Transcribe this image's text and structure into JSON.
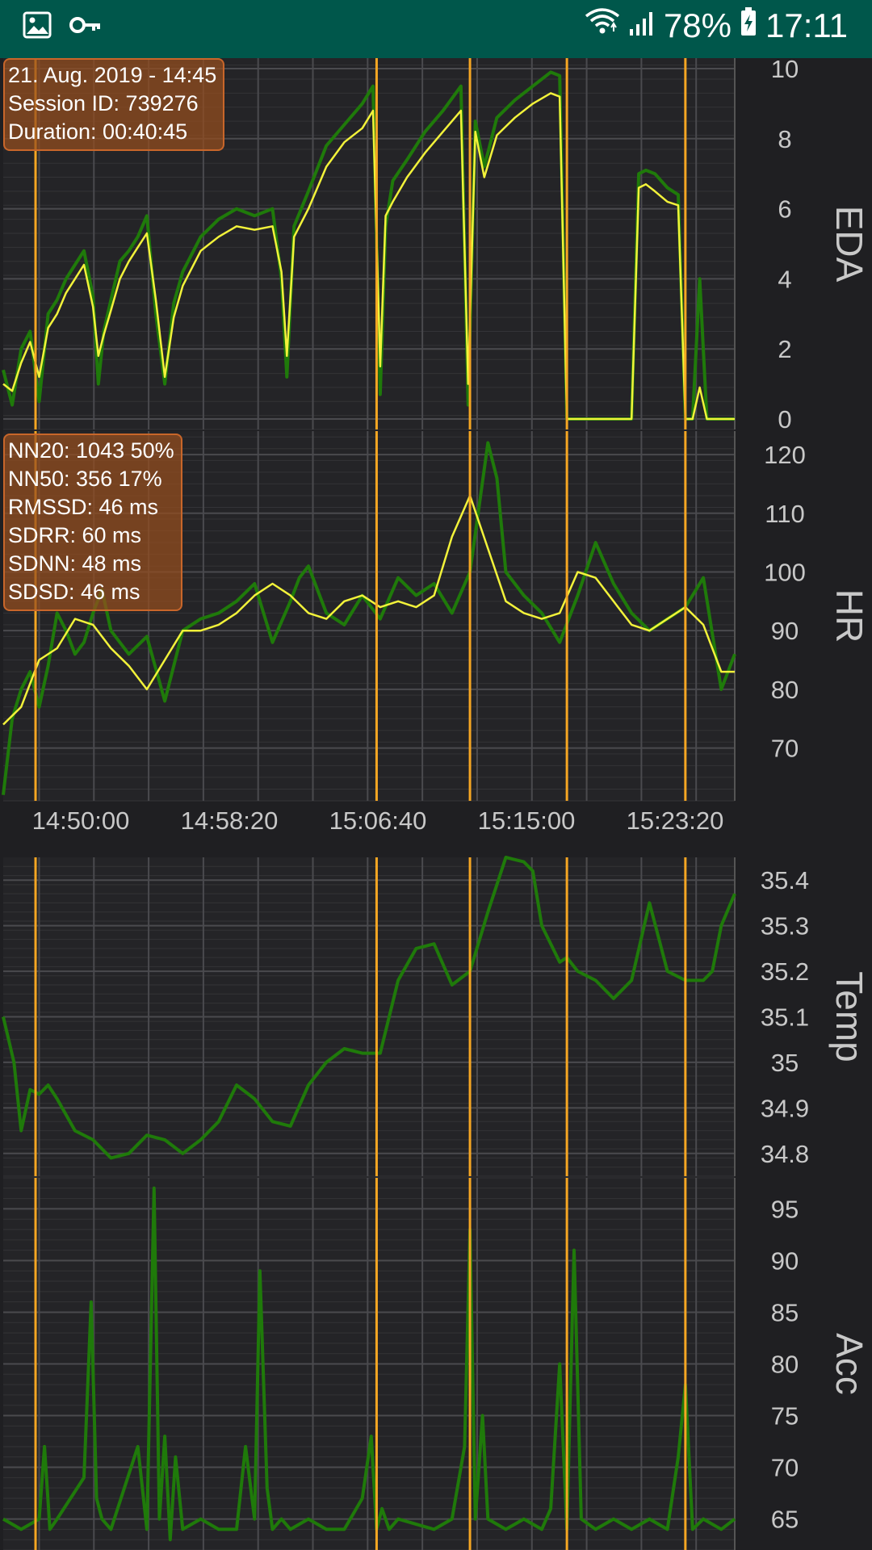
{
  "status_bar": {
    "battery": "78%",
    "time": "17:11",
    "icons": [
      "image-icon",
      "key-icon",
      "wifi-icon",
      "signal-icon",
      "battery-charging-icon"
    ]
  },
  "session_info": {
    "date": "21. Aug. 2019 - 14:45",
    "session_id": "Session ID: 739276",
    "duration": "Duration: 00:40:45"
  },
  "hrv_stats": {
    "nn20": "NN20: 1043 50%",
    "nn50": "NN50: 356 17%",
    "rmssd": "RMSSD: 46 ms",
    "sdrr": "SDRR: 60 ms",
    "sdnn": "SDNN: 48 ms",
    "sdsd": "SDSD: 46 ms"
  },
  "colors": {
    "background": "#1f1f22",
    "status_bar": "#00574b",
    "raw_series": "#1f7a0a",
    "smoothed_series": "#f2f23a",
    "marker": "#f5a623",
    "grid": "#4a4a4e",
    "axis_text": "#c8c8c8"
  },
  "time_axis_labels": [
    "14:50:00",
    "14:58:20",
    "15:06:40",
    "15:15:00",
    "15:23:20"
  ],
  "chart_data": [
    {
      "type": "line",
      "ylabel": "EDA",
      "ylim": [
        -0.3,
        10.3
      ],
      "yticks": [
        0,
        2,
        4,
        6,
        8,
        10
      ],
      "grid": true,
      "x_range_minutes": [
        0,
        40.75
      ],
      "markers_minutes": [
        1.8,
        20.8,
        26.0,
        31.4,
        38.0
      ],
      "series": [
        {
          "role": "raw",
          "x": [
            0,
            0.5,
            1.0,
            1.5,
            2.0,
            2.5,
            3.0,
            3.5,
            4.0,
            4.5,
            5.0,
            5.3,
            5.6,
            6.0,
            6.5,
            7.0,
            7.5,
            8.0,
            8.5,
            9.0,
            9.5,
            10.0,
            11.0,
            12.0,
            13.0,
            14.0,
            15.0,
            15.5,
            15.8,
            16.2,
            17.0,
            18.0,
            19.0,
            20.0,
            20.6,
            21.0,
            21.3,
            21.7,
            22.5,
            23.5,
            24.5,
            25.5,
            25.9,
            26.3,
            26.8,
            27.5,
            28.5,
            29.5,
            30.5,
            31.0,
            31.4,
            31.7,
            32.0,
            33.0,
            34.0,
            35.0,
            35.4,
            35.8,
            36.3,
            37.0,
            37.6,
            38.0,
            38.4,
            38.8,
            39.2,
            39.8,
            40.75
          ],
          "values": [
            1.4,
            0.4,
            2.0,
            2.5,
            0.5,
            3.0,
            3.4,
            4.0,
            4.4,
            4.8,
            3.5,
            1.0,
            2.5,
            3.4,
            4.5,
            4.8,
            5.2,
            5.8,
            3.0,
            1.0,
            3.3,
            4.2,
            5.2,
            5.7,
            6.0,
            5.8,
            6.0,
            4.0,
            1.2,
            5.5,
            6.5,
            7.8,
            8.4,
            9.0,
            9.5,
            0.7,
            5.5,
            6.8,
            7.4,
            8.2,
            8.8,
            9.5,
            0.4,
            8.5,
            7.2,
            8.6,
            9.1,
            9.5,
            9.9,
            9.8,
            0.0,
            0.0,
            0.0,
            0.0,
            0.0,
            0.0,
            7.0,
            7.1,
            7.0,
            6.6,
            6.4,
            0.0,
            0.0,
            4.0,
            0.0,
            0.0,
            0.0
          ]
        },
        {
          "role": "smoothed",
          "x": [
            0,
            0.5,
            1.0,
            1.5,
            2.0,
            2.5,
            3.0,
            3.5,
            4.0,
            4.5,
            5.0,
            5.3,
            5.6,
            6.0,
            6.5,
            7.0,
            7.5,
            8.0,
            8.5,
            9.0,
            9.5,
            10.0,
            11.0,
            12.0,
            13.0,
            14.0,
            15.0,
            15.5,
            15.8,
            16.2,
            17.0,
            18.0,
            19.0,
            20.0,
            20.6,
            21.0,
            21.3,
            21.7,
            22.5,
            23.5,
            24.5,
            25.5,
            25.9,
            26.3,
            26.8,
            27.5,
            28.5,
            29.5,
            30.5,
            31.0,
            31.4,
            31.7,
            32.0,
            33.0,
            34.0,
            35.0,
            35.4,
            35.8,
            36.3,
            37.0,
            37.6,
            38.0,
            38.4,
            38.8,
            39.2,
            39.8,
            40.75
          ],
          "values": [
            1.0,
            0.8,
            1.6,
            2.2,
            1.2,
            2.6,
            3.0,
            3.6,
            4.0,
            4.4,
            3.2,
            1.8,
            2.4,
            3.1,
            4.0,
            4.5,
            4.9,
            5.3,
            3.4,
            1.2,
            2.9,
            3.8,
            4.8,
            5.2,
            5.5,
            5.4,
            5.5,
            4.2,
            1.8,
            5.2,
            6.0,
            7.2,
            7.9,
            8.3,
            8.8,
            1.5,
            5.8,
            6.2,
            6.9,
            7.6,
            8.2,
            8.8,
            1.0,
            8.2,
            6.9,
            8.1,
            8.6,
            9.0,
            9.3,
            9.2,
            0.0,
            0.0,
            0.0,
            0.0,
            0.0,
            0.0,
            6.6,
            6.7,
            6.5,
            6.2,
            6.1,
            0.0,
            0.0,
            0.9,
            0.0,
            0.0,
            0.0
          ]
        }
      ]
    },
    {
      "type": "line",
      "ylabel": "HR",
      "ylim": [
        61,
        124
      ],
      "yticks": [
        70,
        80,
        90,
        100,
        110,
        120
      ],
      "grid": true,
      "x_range_minutes": [
        0,
        40.75
      ],
      "markers_minutes": [
        1.8,
        20.8,
        26.0,
        31.4,
        38.0
      ],
      "series": [
        {
          "role": "raw",
          "x": [
            0,
            0.5,
            1.0,
            1.5,
            2.0,
            2.5,
            3.0,
            3.5,
            4.0,
            4.5,
            5.0,
            5.5,
            6.0,
            7.0,
            8.0,
            9.0,
            10.0,
            11.0,
            12.0,
            13.0,
            14.0,
            15.0,
            16.0,
            16.5,
            17.0,
            18.0,
            19.0,
            20.0,
            21.0,
            22.0,
            23.0,
            24.0,
            25.0,
            26.0,
            27.0,
            27.5,
            28.0,
            29.0,
            30.0,
            31.0,
            32.0,
            33.0,
            34.0,
            35.0,
            36.0,
            37.0,
            38.0,
            39.0,
            40.0,
            40.75
          ],
          "values": [
            62,
            75,
            80,
            83,
            77,
            84,
            93,
            90,
            86,
            88,
            93,
            97,
            90,
            86,
            89,
            78,
            90,
            92,
            93,
            95,
            98,
            88,
            95,
            99,
            101,
            93,
            91,
            96,
            92,
            99,
            96,
            98,
            93,
            100,
            122,
            116,
            100,
            96,
            93,
            88,
            96,
            105,
            98,
            93,
            90,
            92,
            94,
            99,
            80,
            86
          ]
        },
        {
          "role": "smoothed",
          "x": [
            0,
            1.0,
            2.0,
            3.0,
            4.0,
            5.0,
            6.0,
            7.0,
            8.0,
            9.0,
            10.0,
            11.0,
            12.0,
            13.0,
            14.0,
            15.0,
            16.0,
            17.0,
            18.0,
            19.0,
            20.0,
            21.0,
            22.0,
            23.0,
            24.0,
            25.0,
            26.0,
            27.0,
            28.0,
            29.0,
            30.0,
            31.0,
            32.0,
            33.0,
            34.0,
            35.0,
            36.0,
            37.0,
            38.0,
            39.0,
            40.0,
            40.75
          ],
          "values": [
            74,
            77,
            85,
            87,
            92,
            91,
            87,
            84,
            80,
            85,
            90,
            90,
            91,
            93,
            96,
            98,
            96,
            93,
            92,
            95,
            96,
            94,
            95,
            94,
            96,
            106,
            113,
            104,
            95,
            93,
            92,
            93,
            100,
            99,
            95,
            91,
            90,
            92,
            94,
            91,
            83,
            83
          ]
        }
      ]
    },
    {
      "type": "line",
      "ylabel": "Temp",
      "ylim": [
        34.75,
        35.45
      ],
      "yticks": [
        34.8,
        34.9,
        35,
        35.1,
        35.2,
        35.3,
        35.4
      ],
      "grid": true,
      "x_range_minutes": [
        0,
        40.75
      ],
      "markers_minutes": [
        1.8,
        20.8,
        26.0,
        31.4,
        38.0
      ],
      "series": [
        {
          "role": "raw",
          "x": [
            0,
            0.6,
            1.0,
            1.5,
            2.0,
            2.5,
            3.0,
            4.0,
            5.0,
            6.0,
            7.0,
            8.0,
            9.0,
            10.0,
            11.0,
            12.0,
            13.0,
            14.0,
            15.0,
            16.0,
            17.0,
            18.0,
            19.0,
            20.0,
            21.0,
            22.0,
            23.0,
            24.0,
            25.0,
            26.0,
            27.0,
            28.0,
            29.0,
            29.5,
            30.0,
            31.0,
            31.4,
            32.0,
            33.0,
            34.0,
            35.0,
            36.0,
            37.0,
            38.0,
            39.0,
            39.5,
            40.0,
            40.75
          ],
          "values": [
            35.1,
            35.0,
            34.85,
            34.94,
            34.93,
            34.95,
            34.92,
            34.85,
            34.83,
            34.79,
            34.8,
            34.84,
            34.83,
            34.8,
            34.83,
            34.87,
            34.95,
            34.92,
            34.87,
            34.86,
            34.95,
            35.0,
            35.03,
            35.02,
            35.02,
            35.18,
            35.25,
            35.26,
            35.17,
            35.2,
            35.33,
            35.45,
            35.44,
            35.42,
            35.3,
            35.22,
            35.23,
            35.2,
            35.18,
            35.14,
            35.18,
            35.35,
            35.2,
            35.18,
            35.18,
            35.2,
            35.3,
            35.37
          ]
        }
      ]
    },
    {
      "type": "line",
      "ylabel": "Acc",
      "ylim": [
        62,
        98
      ],
      "yticks": [
        65,
        70,
        75,
        80,
        85,
        90,
        95
      ],
      "grid": true,
      "x_range_minutes": [
        0,
        40.75
      ],
      "markers_minutes": [
        1.8,
        20.8,
        26.0,
        31.4,
        38.0
      ],
      "series": [
        {
          "role": "raw",
          "x": [
            0,
            1.0,
            2.0,
            2.3,
            2.6,
            3.0,
            4.5,
            4.9,
            5.2,
            5.5,
            6.0,
            7.5,
            8.0,
            8.4,
            8.7,
            9.0,
            9.3,
            9.6,
            10.0,
            11.0,
            12.0,
            13.0,
            13.5,
            14.0,
            14.3,
            14.7,
            15.0,
            15.5,
            16.0,
            17.0,
            18.0,
            19.0,
            20.0,
            20.5,
            20.8,
            21.1,
            21.5,
            22.0,
            24.0,
            25.0,
            25.7,
            26.0,
            26.3,
            26.7,
            27.0,
            28.0,
            29.0,
            30.0,
            30.5,
            31.0,
            31.4,
            31.8,
            32.2,
            33.0,
            34.0,
            35.0,
            36.0,
            37.0,
            37.6,
            38.0,
            38.4,
            39.0,
            40.0,
            40.75
          ],
          "values": [
            65,
            64,
            65,
            72,
            64,
            65,
            69,
            86,
            67,
            65,
            64,
            72,
            64,
            97,
            65,
            73,
            63,
            71,
            64,
            65,
            64,
            64,
            72,
            65,
            89,
            68,
            64,
            65,
            64,
            65,
            64,
            64,
            67,
            73,
            64,
            66,
            64,
            65,
            64,
            65,
            72,
            93,
            65,
            75,
            65,
            64,
            65,
            64,
            66,
            80,
            64,
            91,
            65,
            64,
            65,
            64,
            65,
            64,
            71,
            78,
            64,
            65,
            64,
            65
          ]
        }
      ]
    }
  ]
}
